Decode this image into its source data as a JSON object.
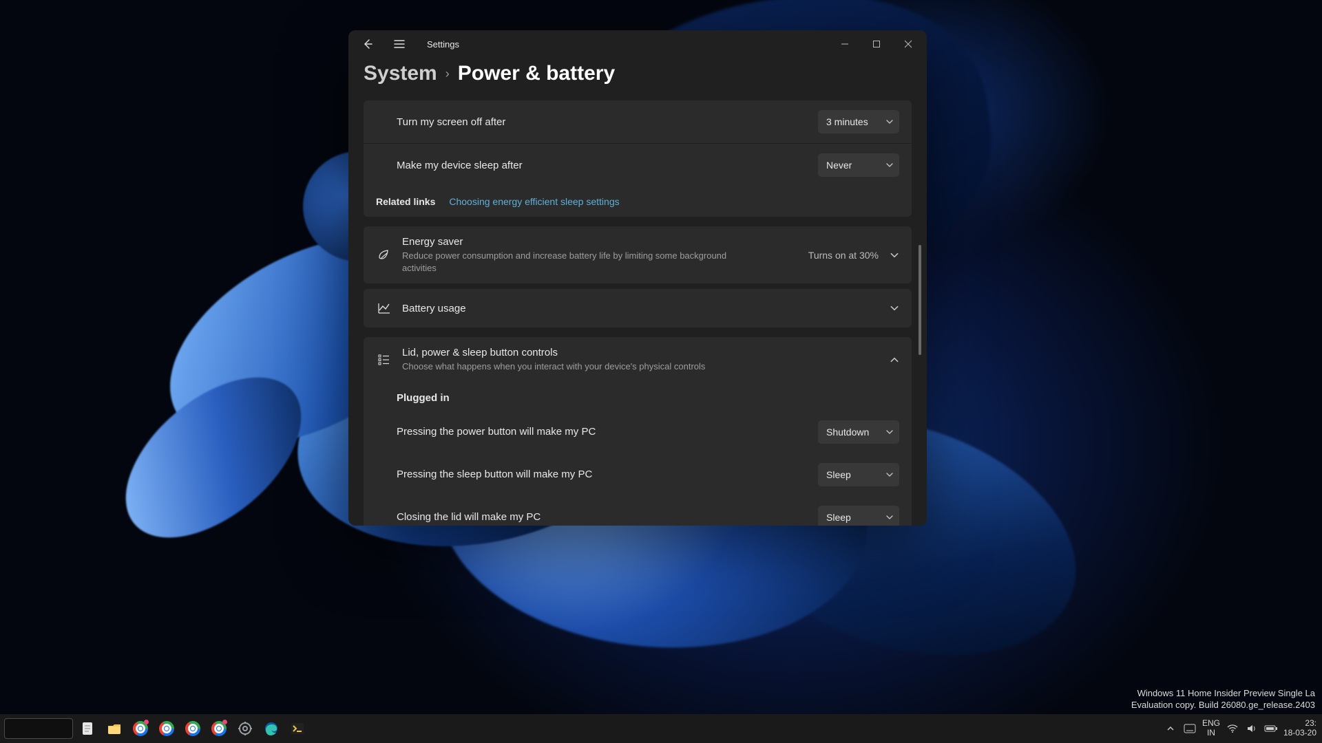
{
  "window": {
    "title": "Settings"
  },
  "breadcrumb": {
    "root": "System",
    "page": "Power & battery"
  },
  "screenOff": {
    "label": "Turn my screen off after",
    "value": "3 minutes"
  },
  "deviceSleep": {
    "label": "Make my device sleep after",
    "value": "Never"
  },
  "related": {
    "label": "Related links",
    "link": "Choosing energy efficient sleep settings"
  },
  "energySaver": {
    "title": "Energy saver",
    "desc": "Reduce power consumption and increase battery life by limiting some background activities",
    "status": "Turns on at 30%"
  },
  "batteryUsage": {
    "title": "Battery usage"
  },
  "lidControls": {
    "title": "Lid, power & sleep button controls",
    "desc": "Choose what happens when you interact with your device's physical controls"
  },
  "pluggedInHeader": "Plugged in",
  "powerButton": {
    "label": "Pressing the power button will make my PC",
    "value": "Shutdown"
  },
  "sleepButton": {
    "label": "Pressing the sleep button will make my PC",
    "value": "Sleep"
  },
  "closeLid": {
    "label": "Closing the lid will make my PC",
    "value": "Sleep"
  },
  "watermark": {
    "line1": "Windows 11 Home Insider Preview Single La",
    "line2": "Evaluation copy. Build 26080.ge_release.2403"
  },
  "tray": {
    "lang1": "ENG",
    "lang2": "IN",
    "time": "23:",
    "date": "18-03-20"
  }
}
